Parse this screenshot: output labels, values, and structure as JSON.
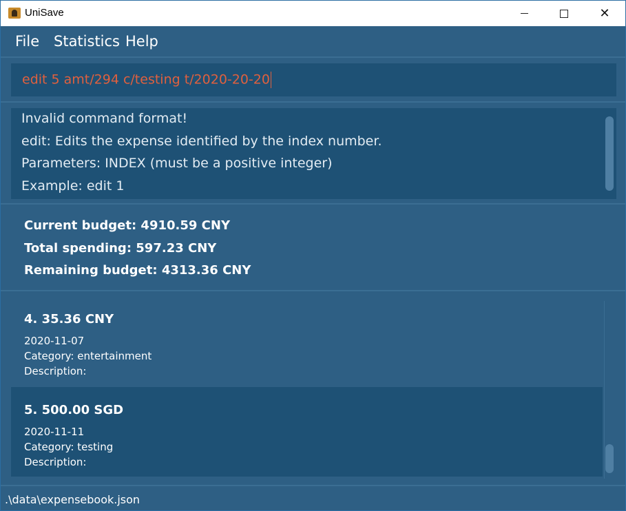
{
  "window": {
    "title": "UniSave",
    "minimize_glyph": "minimize",
    "maximize_glyph": "maximize",
    "close_glyph": "✕"
  },
  "menu": {
    "file": "File",
    "statistics": "Statistics",
    "help": "Help"
  },
  "command": {
    "value": "edit 5 amt/294 c/testing t/2020-20-20",
    "text_color": "#e0603e"
  },
  "result": {
    "lines": [
      "Invalid command format!",
      "edit: Edits the expense identified by the index number.",
      "Parameters: INDEX (must be a positive integer)",
      "Example: edit 1"
    ]
  },
  "budget": {
    "current": "Current budget: 4910.59 CNY",
    "spending": "Total spending: 597.23 CNY",
    "remaining": "Remaining budget: 4313.36 CNY"
  },
  "expenses": [
    {
      "title": "4.  35.36 CNY",
      "date": "2020-11-07",
      "category": "Category: entertainment",
      "description": "Description:"
    },
    {
      "title": "5.  500.00 SGD",
      "date": "2020-11-11",
      "category": "Category: testing",
      "description": "Description:"
    }
  ],
  "status": {
    "path": ".\\data\\expensebook.json"
  },
  "colors": {
    "background": "#2e5f84",
    "panel": "#1e5175",
    "accent_error": "#e0603e"
  }
}
